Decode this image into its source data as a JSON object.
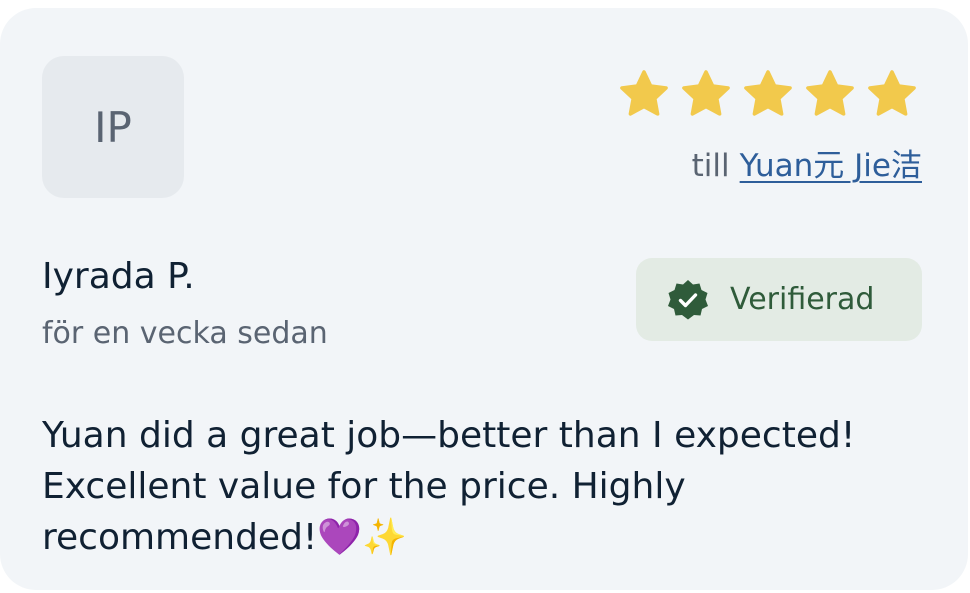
{
  "review": {
    "avatar_initials": "IP",
    "rating": 5,
    "rating_max": 5,
    "star_color": "#f2c94c",
    "recipient_prefix": "till",
    "recipient_name": "Yuan元 Jie洁",
    "reviewer_name": "Iyrada P.",
    "time_ago": "för en vecka sedan",
    "verified_label": "Verifierad",
    "verified_icon": "check-badge-icon",
    "text": "Yuan did a great job—better than I expected! Excellent value for the price. Highly recommended!💜✨"
  }
}
